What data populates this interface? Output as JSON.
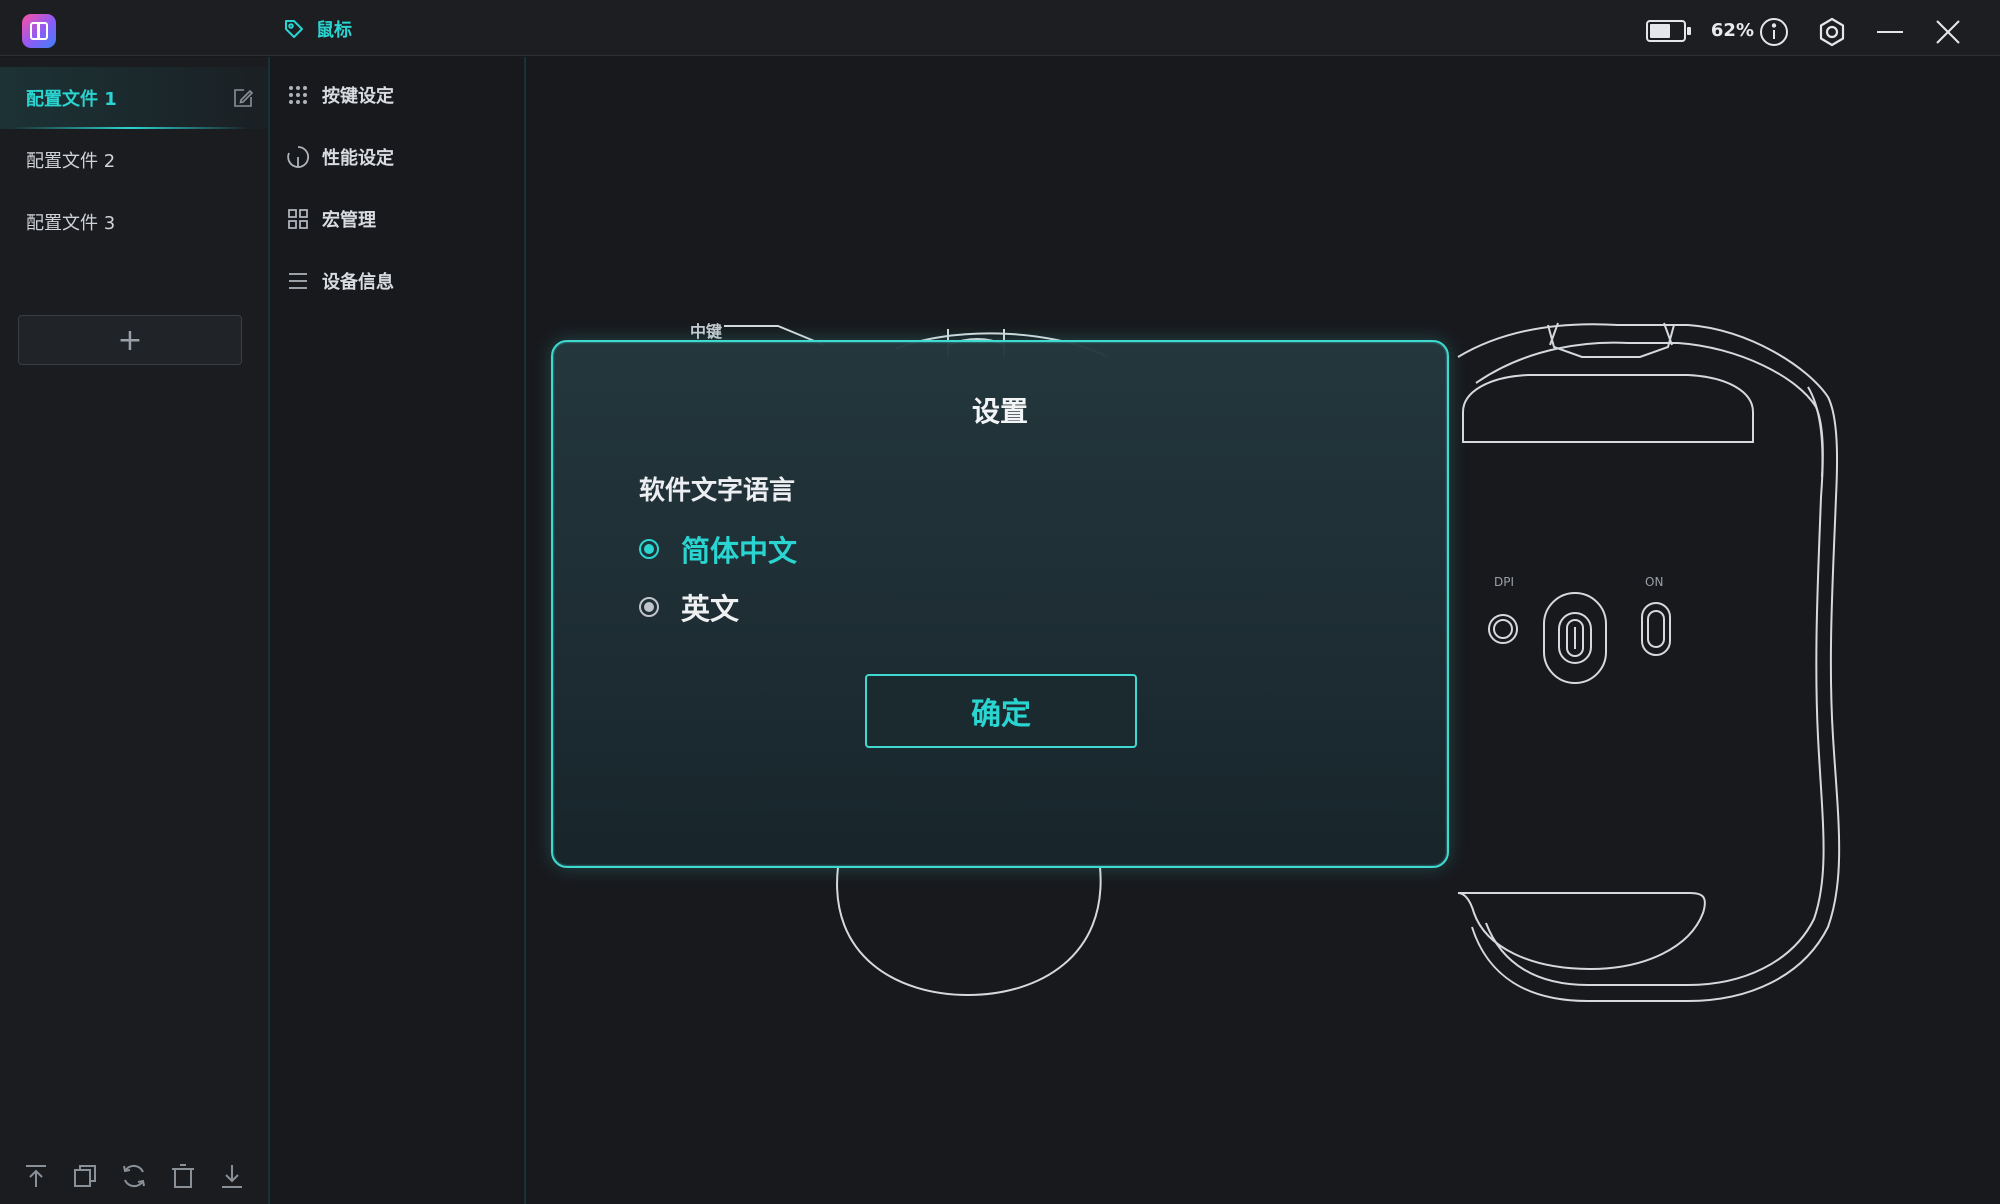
{
  "titlebar": {
    "tab_label": "鼠标",
    "battery_percent": "62%",
    "battery_level": 0.62
  },
  "profiles": {
    "items": [
      {
        "label": "配置文件 1",
        "active": true
      },
      {
        "label": "配置文件 2",
        "active": false
      },
      {
        "label": "配置文件 3",
        "active": false
      }
    ],
    "add_label": "+"
  },
  "menu": {
    "items": [
      {
        "label": "按键设定",
        "icon": "grid-dots-icon"
      },
      {
        "label": "性能设定",
        "icon": "gauge-icon"
      },
      {
        "label": "宏管理",
        "icon": "squares-icon"
      },
      {
        "label": "设备信息",
        "icon": "list-icon"
      }
    ]
  },
  "mouse": {
    "label_middle": "中键",
    "label_dpi": "DPI",
    "label_on": "ON"
  },
  "dialog": {
    "title": "设置",
    "section_label": "软件文字语言",
    "options": [
      {
        "label": "简体中文",
        "selected": true
      },
      {
        "label": "英文",
        "selected": false
      }
    ],
    "confirm_label": "确定"
  },
  "colors": {
    "accent": "#2ad4d0",
    "background": "#17191d",
    "dialog_border": "#3fd9cf"
  }
}
